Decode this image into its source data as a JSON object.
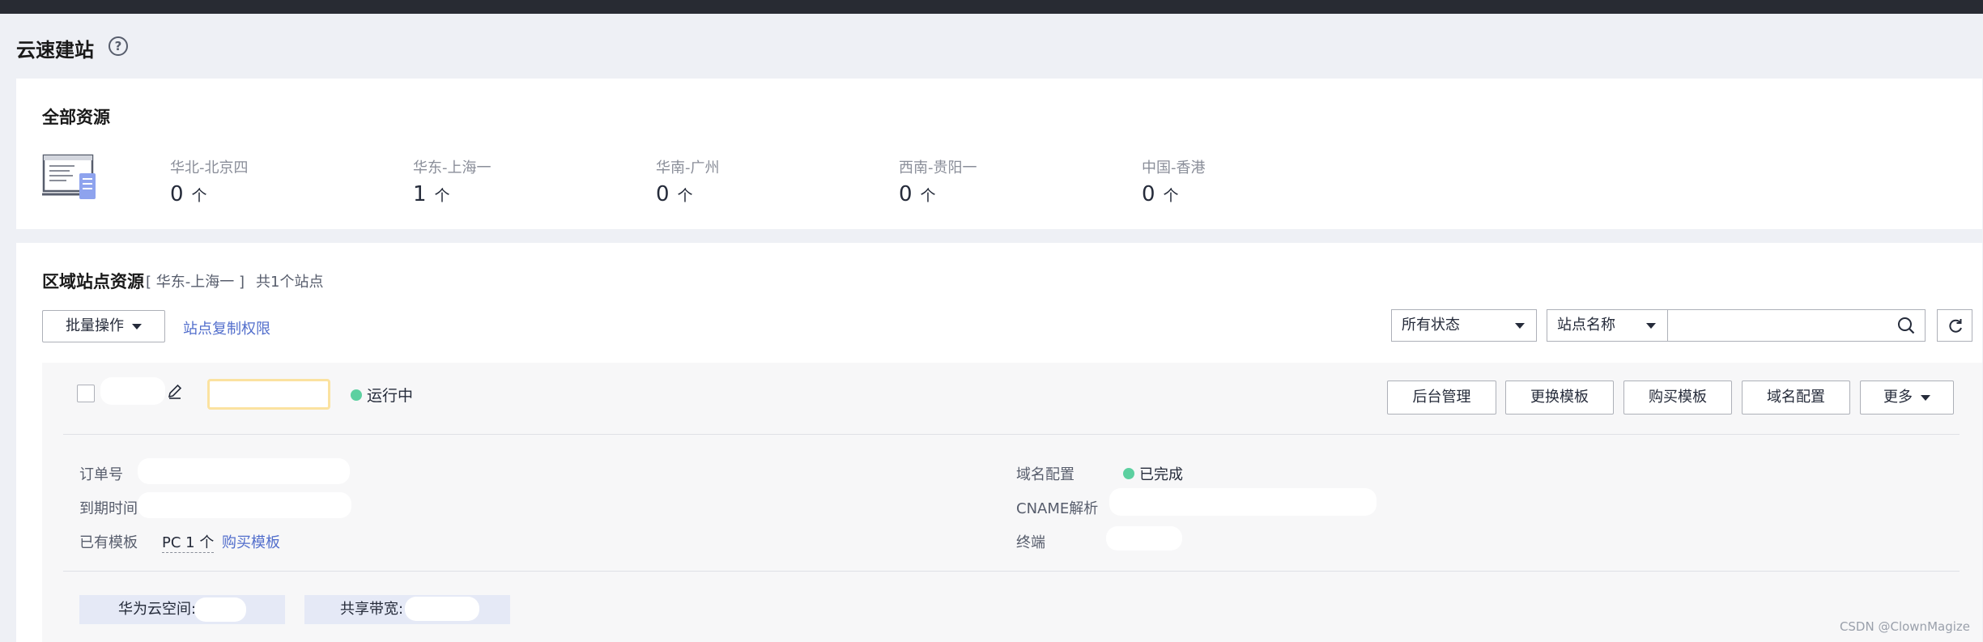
{
  "page": {
    "title": "云速建站",
    "help_glyph": "?"
  },
  "all_resources": {
    "title": "全部资源",
    "unit": "个",
    "regions": [
      {
        "name": "华北-北京四",
        "count": "0"
      },
      {
        "name": "华东-上海一",
        "count": "1"
      },
      {
        "name": "华南-广州",
        "count": "0"
      },
      {
        "name": "西南-贵阳一",
        "count": "0"
      },
      {
        "name": "中国-香港",
        "count": "0"
      }
    ]
  },
  "region_sites": {
    "title": "区域站点资源",
    "current_region": "[ 华东-上海一 ]",
    "total": "共1个站点",
    "batch_button": "批量操作",
    "copy_permission_link": "站点复制权限",
    "status_filter": "所有状态",
    "search_field_select": "站点名称",
    "search_placeholder": ""
  },
  "site": {
    "status": "运行中",
    "actions": {
      "admin": "后台管理",
      "change_template": "更换模板",
      "buy_template": "购买模板",
      "domain_config": "域名配置",
      "more": "更多"
    },
    "fields": {
      "order_label": "订单号",
      "expire_label": "到期时间",
      "template_label": "已有模板",
      "template_value": "PC 1 个",
      "buy_template_link": "购买模板",
      "domain_label": "域名配置",
      "domain_status": "已完成",
      "cname_label": "CNAME解析",
      "terminal_label": "终端"
    },
    "chips": {
      "space": "华为云空间:",
      "bandwidth": "共享带宽:"
    }
  },
  "watermark": "CSDN @ClownMagize",
  "colors": {
    "topbar": "#282b33",
    "link": "#526ecc",
    "status_green": "#5cd0a0",
    "chip_bg": "#e5e9f6"
  }
}
